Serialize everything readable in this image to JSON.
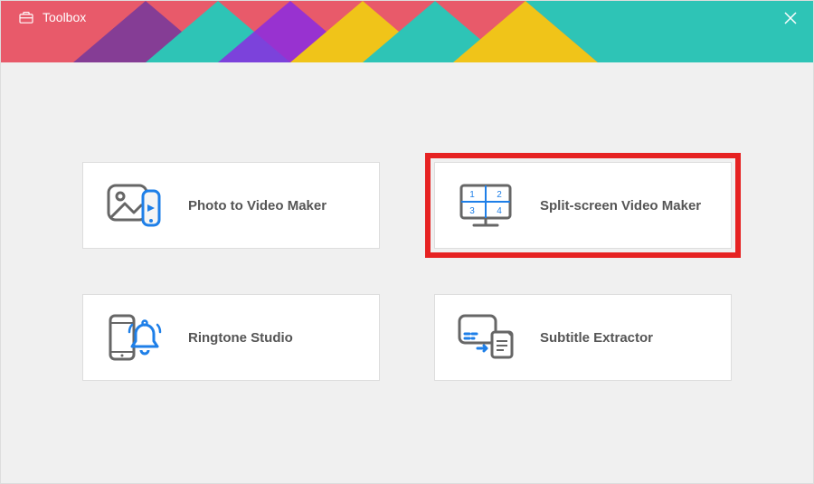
{
  "window": {
    "title": "Toolbox"
  },
  "cards": [
    {
      "label": "Photo to Video Maker"
    },
    {
      "label": "Split-screen Video Maker"
    },
    {
      "label": "Ringtone Studio"
    },
    {
      "label": "Subtitle Extractor"
    }
  ],
  "splitscreen": {
    "q1": "1",
    "q2": "2",
    "q3": "3",
    "q4": "4"
  }
}
